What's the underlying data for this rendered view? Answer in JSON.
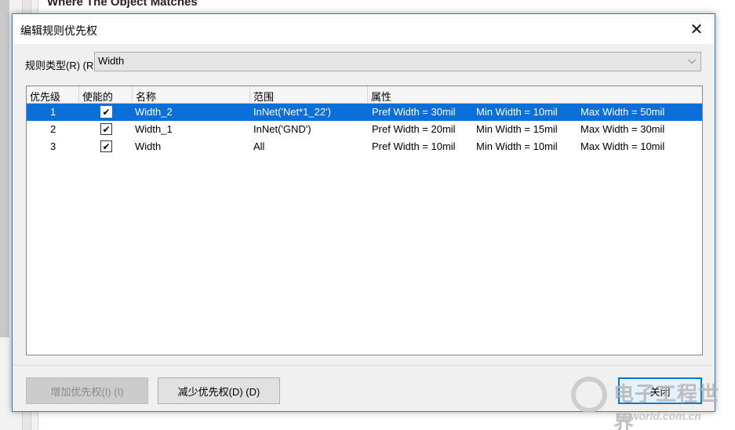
{
  "background": {
    "title": "Where The Object Matches"
  },
  "dialog": {
    "title": "编辑规则优先权",
    "close_glyph": "✕",
    "rule_type_label": "规则类型(R) (R",
    "rule_type_value": "Width",
    "chevron_glyph": "⌵",
    "columns": [
      "优先级",
      "使能的",
      "名称",
      "范围",
      "属性"
    ],
    "rows": [
      {
        "priority": "1",
        "enabled": true,
        "name": "Width_2",
        "scope": "InNet('Net*1_22')",
        "pref": "Pref Width = 30mil",
        "min": "Min Width = 10mil",
        "max": "Max Width = 50mil",
        "selected": true
      },
      {
        "priority": "2",
        "enabled": true,
        "name": "Width_1",
        "scope": "InNet('GND')",
        "pref": "Pref Width = 20mil",
        "min": "Min Width = 15mil",
        "max": "Max Width = 30mil",
        "selected": false
      },
      {
        "priority": "3",
        "enabled": true,
        "name": "Width",
        "scope": "All",
        "pref": "Pref Width = 10mil",
        "min": "Min Width = 10mil",
        "max": "Max Width = 10mil",
        "selected": false
      }
    ],
    "check_glyph": "✔",
    "increase_button": "增加优先权(I) (I)",
    "decrease_button": "减少优先权(D) (D)",
    "close_button": "关闭"
  },
  "watermark": {
    "line1": "电子工程世界",
    "line2": "eeworld.com.cn"
  }
}
